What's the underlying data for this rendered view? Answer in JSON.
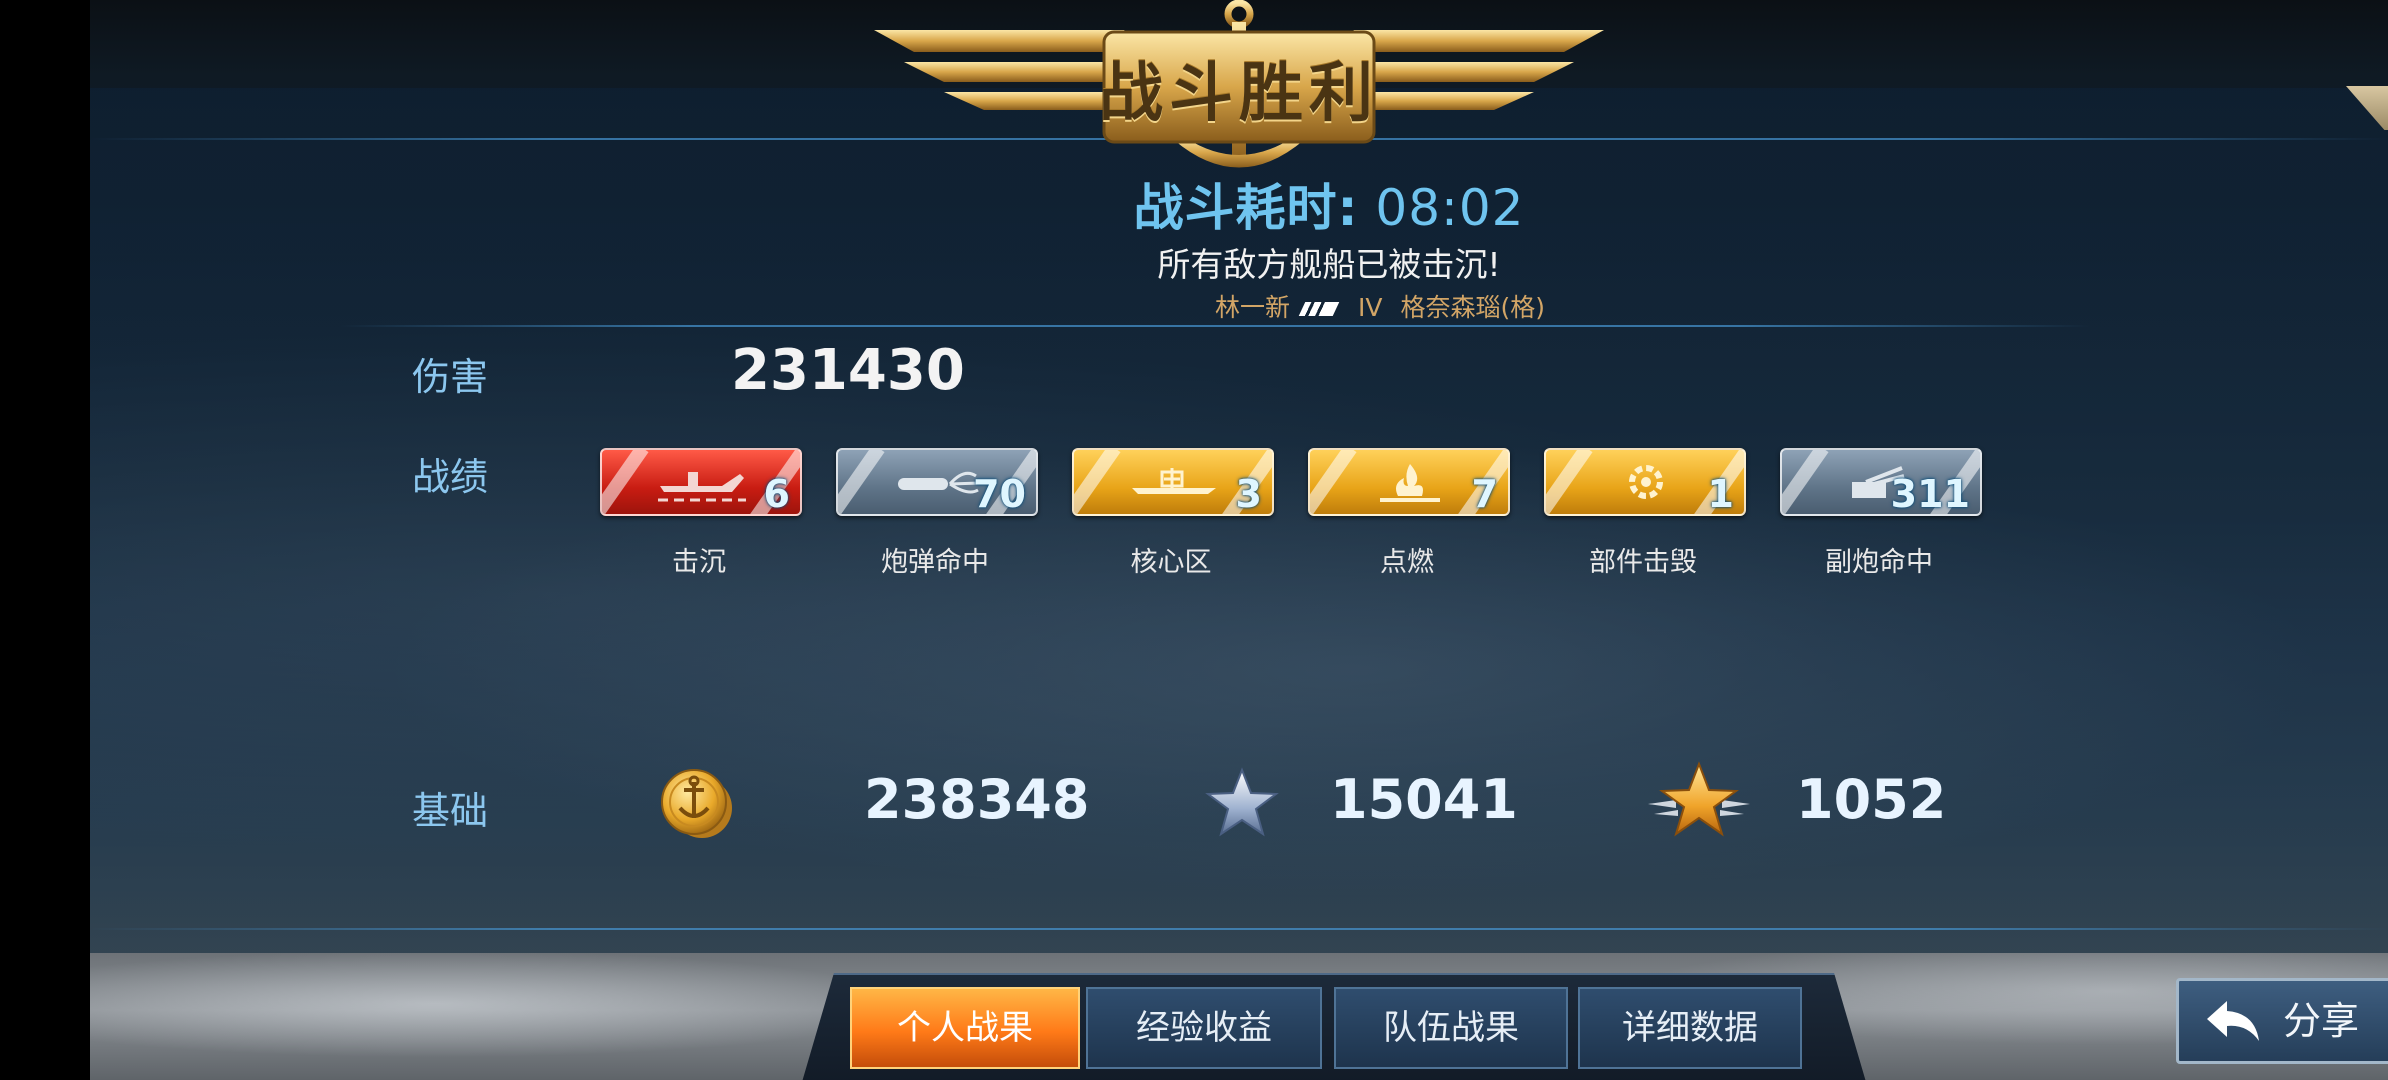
{
  "banner": {
    "title": "战斗胜利"
  },
  "header": {
    "time_label": "战斗耗时:",
    "time_value": "08:02",
    "result_message": "所有敌方舰船已被击沉!",
    "player_name": "林一新",
    "ship_tier": "IV",
    "ship_name": "格奈森瑙(格)"
  },
  "close_icon": "close-icon",
  "damage": {
    "label": "伤害",
    "value": "231430"
  },
  "record": {
    "label": "战绩",
    "badges": [
      {
        "icon": "sunk-ship-icon",
        "value": "6",
        "caption": "击沉",
        "color": "#d6281b"
      },
      {
        "icon": "shell-hit-icon",
        "value": "70",
        "caption": "炮弹命中",
        "color": "#6a7f93"
      },
      {
        "icon": "citadel-icon",
        "value": "3",
        "caption": "核心区",
        "color": "#e8a418"
      },
      {
        "icon": "fire-icon",
        "value": "7",
        "caption": "点燃",
        "color": "#e8a418"
      },
      {
        "icon": "module-destroyed-icon",
        "value": "1",
        "caption": "部件击毁",
        "color": "#e8a418"
      },
      {
        "icon": "secondary-battery-icon",
        "value": "311",
        "caption": "副炮命中",
        "color": "#6a7f93"
      }
    ]
  },
  "base": {
    "label": "基础",
    "credits": {
      "icon": "gold-coin-icon",
      "value": "238348"
    },
    "experience": {
      "icon": "silver-star-icon",
      "value": "15041"
    },
    "commander_xp": {
      "icon": "gold-star-icon",
      "value": "1052"
    }
  },
  "tabs": [
    {
      "label": "个人战果",
      "active": true
    },
    {
      "label": "经验收益",
      "active": false
    },
    {
      "label": "队伍战果",
      "active": false
    },
    {
      "label": "详细数据",
      "active": false
    }
  ],
  "share": {
    "label": "分享",
    "icon": "share-arrow-icon"
  }
}
